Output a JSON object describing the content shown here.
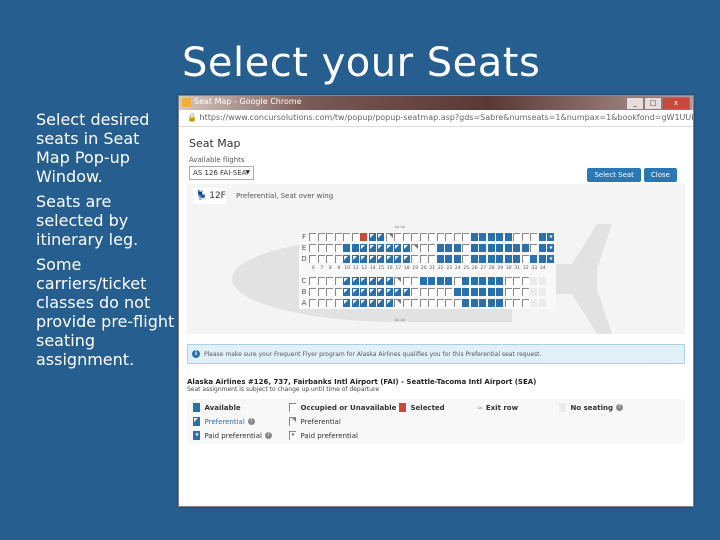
{
  "slide": {
    "title": "Select your Seats",
    "bullets": [
      "Select desired seats in Seat Map Pop-up Window.",
      "Seats are selected by itinerary leg.",
      "Some carriers/ticket classes do not provide pre-flight seating assignment."
    ]
  },
  "window": {
    "title": "Seat Map - Google Chrome",
    "controls": [
      "_",
      "□",
      "x"
    ],
    "url": "https://www.concursolutions.com/tw/popup/popup-seatmap.asp?gds=Sabre&numseats=1&numpax=1&bookfond=gW1UUb4Bl2Kh1z1..."
  },
  "seatmap": {
    "heading": "Seat Map",
    "available_flights_label": "Available flights",
    "selected_flight": "AS 126 FAI-SEA",
    "select_seat_button": "Select Seat",
    "close_button": "Close",
    "selected_seat": "12F",
    "selected_seat_desc": "Preferential, Seat over wing",
    "row_letters_top": [
      "F",
      "E",
      "D"
    ],
    "row_letters_bottom": [
      "C",
      "B",
      "A"
    ],
    "row_numbers": [
      "6",
      "7",
      "8",
      "9",
      "10",
      "11",
      "12",
      "14",
      "15",
      "16",
      "17",
      "18",
      "19",
      "20",
      "21",
      "22",
      "23",
      "24",
      "25",
      "26",
      "27",
      "28",
      "29",
      "30",
      "31",
      "32",
      "33",
      "34"
    ],
    "exit_mark": "≈",
    "seat_codes_legend": "o=occupied, a=available, p=preferential, q=occupied preferential, s=selected, n=no seating, P=paid preferential avail, Q=paid preferential occupied",
    "rows": {
      "F": "oooooosppqoooooooooaaaaaoooaP",
      "E": "ooooaappppppqooaaaoaaaaaaaoaP",
      "D": "ooooppppppppoooaaaoaaaaaaoaaP",
      "C": "ooooppppppqooaaaaoaaaaaooonn",
      "B": "ooooppppppppoooooaaaaaaooonn",
      "A": "ooooppppppqoooooooaaaaaooonn"
    },
    "notice": "Please make sure your Frequent Flyer program for Alaska Airlines qualifies you for this Preferential seat request.",
    "flight_line": "Alaska Airlines #126, 737, Fairbanks Intl Airport (FAI) - Seattle-Tacoma Intl Airport (SEA)",
    "flight_note": "Seat assignment is subject to change up until time of departure",
    "legend": {
      "available": "Available",
      "preferential_avail": "Preferential",
      "paid_preferential_avail": "Paid preferential",
      "occupied": "Occupied or Unavailable",
      "preferential_occ": "Preferential",
      "paid_preferential_occ": "Paid preferential",
      "selected": "Selected",
      "exit_row": "Exit row",
      "no_seating": "No seating",
      "help": "?"
    },
    "colors": {
      "available": "#2a70ad",
      "selected": "#c8483a",
      "background": "#255e8f"
    }
  }
}
